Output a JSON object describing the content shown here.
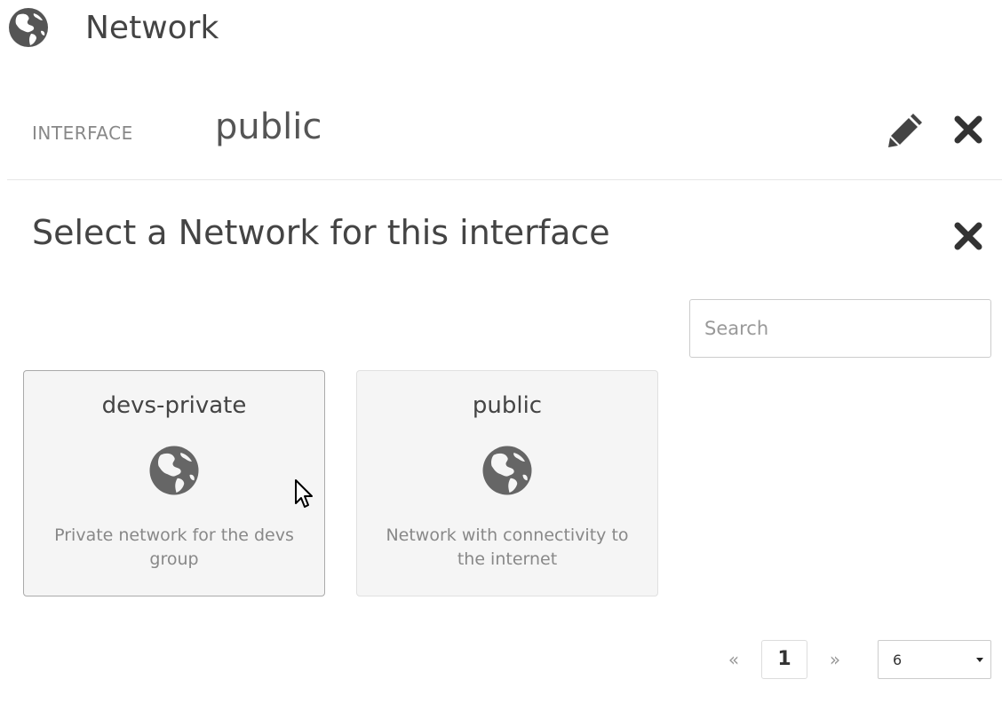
{
  "header": {
    "title": "Network",
    "icon": "globe-icon"
  },
  "interface": {
    "label": "INTERFACE",
    "value": "public",
    "edit_icon": "pencil-icon",
    "close_icon": "close-icon"
  },
  "select": {
    "title": "Select a Network for this interface",
    "close_icon": "close-icon",
    "search_placeholder": "Search",
    "search_value": ""
  },
  "networks": [
    {
      "name": "devs-private",
      "icon": "globe-icon",
      "description": "Private network for the devs group"
    },
    {
      "name": "public",
      "icon": "globe-icon",
      "description": "Network with connectivity to the internet"
    }
  ],
  "pagination": {
    "prev": "«",
    "current": "1",
    "next": "»",
    "page_size": "6"
  },
  "colors": {
    "icon": "#555555",
    "card_bg": "#f5f5f5",
    "text_muted": "#888888"
  }
}
